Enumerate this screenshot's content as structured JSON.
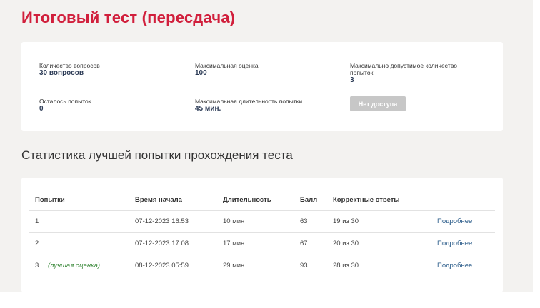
{
  "title": "Итоговый тест (пересдача)",
  "info": {
    "questions_label": "Количество вопросов",
    "questions_value": "30 вопросов",
    "max_score_label": "Максимальная оценка",
    "max_score_value": "100",
    "max_attempts_label": "Максимально допустимое количество попыток",
    "max_attempts_value": "3",
    "remaining_label": "Осталось попыток",
    "remaining_value": "0",
    "max_duration_label": "Максимальная длительность попытки",
    "max_duration_value": "45 мин.",
    "access_button": "Нет доступа"
  },
  "stats_title": "Статистика лучшей попытки прохождения теста",
  "table": {
    "headers": [
      "Попытки",
      "Время начала",
      "Длительность",
      "Балл",
      "Корректные ответы",
      ""
    ],
    "best_label": "(лучшая оценка)",
    "rows": [
      {
        "attempt": "1",
        "start": "07-12-2023 16:53",
        "duration": "10 мин",
        "score": "63",
        "correct": "19 из 30",
        "link": "Подробнее"
      },
      {
        "attempt": "2",
        "start": "07-12-2023 17:08",
        "duration": "17 мин",
        "score": "67",
        "correct": "20 из 30",
        "link": "Подробнее"
      },
      {
        "attempt": "3",
        "start": "08-12-2023 05:59",
        "duration": "29 мин",
        "score": "93",
        "correct": "28 из 30",
        "link": "Подробнее"
      }
    ]
  }
}
